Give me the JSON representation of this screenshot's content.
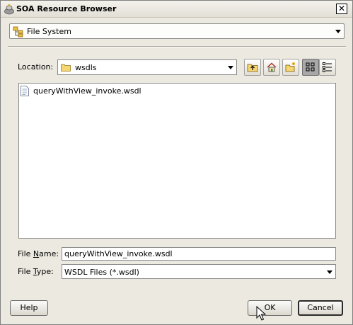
{
  "window": {
    "title": "SOA Resource Browser",
    "close_glyph": "✕"
  },
  "source_selector": {
    "value": "File System",
    "icon": "file-system-icon"
  },
  "location": {
    "label": "Location:",
    "value": "wsdls",
    "icon": "folder-icon"
  },
  "toolbar": {
    "buttons": [
      {
        "name": "up-one-level",
        "icon": "folder-up-icon"
      },
      {
        "name": "home",
        "icon": "home-icon"
      },
      {
        "name": "new-folder",
        "icon": "new-folder-icon"
      },
      {
        "name": "list-view",
        "icon": "list-view-icon",
        "pressed": true
      },
      {
        "name": "details-view",
        "icon": "details-view-icon",
        "pressed": false
      }
    ]
  },
  "files": [
    {
      "name": "queryWithView_invoke.wsdl",
      "icon": "document-icon"
    }
  ],
  "file_name": {
    "label_prefix": "File ",
    "label_mnemonic": "N",
    "label_suffix": "ame:",
    "value": "queryWithView_invoke.wsdl"
  },
  "file_type": {
    "label_prefix": "File ",
    "label_mnemonic": "T",
    "label_suffix": "ype:",
    "value": "WSDL Files (*.wsdl)"
  },
  "buttons": {
    "help": "Help",
    "ok": "OK",
    "cancel": "Cancel"
  }
}
